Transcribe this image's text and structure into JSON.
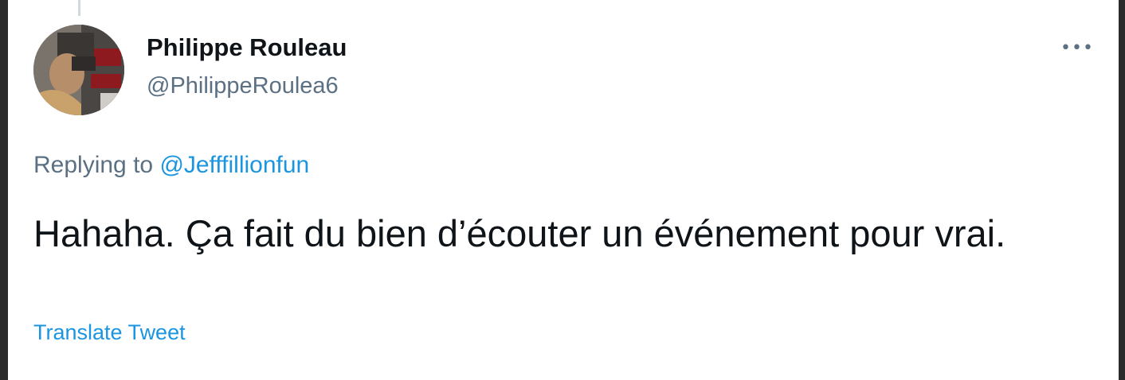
{
  "tweet": {
    "author_name": "Philippe Rouleau",
    "author_handle": "@PhilippeRoulea6",
    "more_icon": "more-horizontal-icon",
    "replying_prefix": "Replying to",
    "replying_to": "@Jefffillionfun",
    "text": "Hahaha. Ça fait du bien d’écouter un événement pour vrai.",
    "translate_label": "Translate Tweet"
  },
  "colors": {
    "accent": "#1b95e0",
    "secondary_text": "#5b7083",
    "primary_text": "#0f1419",
    "background": "#ffffff",
    "outer_frame": "#2b2b2b"
  }
}
